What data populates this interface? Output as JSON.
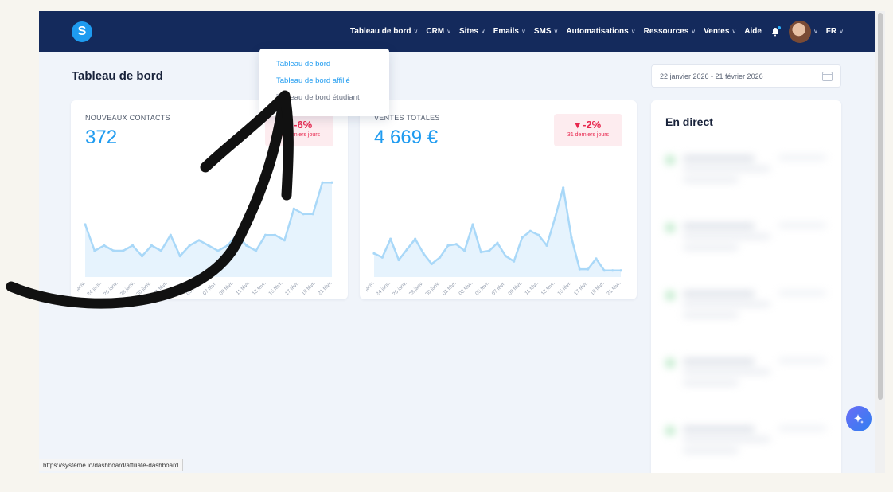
{
  "app": {
    "logo_letter": "S"
  },
  "nav": {
    "items": [
      {
        "label": "Tableau de bord",
        "has_chevron": true
      },
      {
        "label": "CRM",
        "has_chevron": true
      },
      {
        "label": "Sites",
        "has_chevron": true
      },
      {
        "label": "Emails",
        "has_chevron": true
      },
      {
        "label": "SMS",
        "has_chevron": true
      },
      {
        "label": "Automatisations",
        "has_chevron": true
      },
      {
        "label": "Ressources",
        "has_chevron": true
      },
      {
        "label": "Ventes",
        "has_chevron": true
      },
      {
        "label": "Aide",
        "has_chevron": false
      }
    ],
    "language": "FR",
    "icons": {
      "notifications": "bell-icon",
      "avatar": "user-avatar"
    }
  },
  "dropdown": {
    "items": [
      {
        "label": "Tableau de bord"
      },
      {
        "label": "Tableau de bord affilié"
      },
      {
        "label": "Tableau de bord étudiant"
      }
    ]
  },
  "page": {
    "title": "Tableau de bord",
    "date_range": "22 janvier 2026 - 21 février 2026"
  },
  "cards": {
    "contacts": {
      "label": "NOUVEAUX CONTACTS",
      "value": "372",
      "badge_pct": "-6%",
      "badge_sub": "31 derniers jours"
    },
    "sales": {
      "label": "VENTES TOTALES",
      "value": "4 669 €",
      "badge_pct": "-2%",
      "badge_sub": "31 derniers jours"
    },
    "live": {
      "title": "En direct"
    }
  },
  "status_bar": {
    "url": "https://systeme.io/dashboard/affiliate-dashboard"
  },
  "colors": {
    "nav_bg": "#142a5c",
    "accent": "#1e9bf0",
    "negative": "#e8284f",
    "chart_fill": "#e6f3fd"
  },
  "chart_data": [
    {
      "type": "area",
      "categories": [
        "23 janv.",
        "25 janv.",
        "27 janv.",
        "29 janv.",
        "31 janv.",
        "02 févr.",
        "04 févr.",
        "06 févr.",
        "08 févr.",
        "10 févr.",
        "12 févr.",
        "14 févr.",
        "16 févr.",
        "18 févr.",
        "20 févr.",
        "21 févr."
      ],
      "x_tick_labels": [
        "23 janv.",
        "24 janv.",
        "26 janv.",
        "28 janv.",
        "30 janv.",
        "01 févr.",
        "03 févr.",
        "05 févr.",
        "07 févr.",
        "09 févr.",
        "11 févr.",
        "13 févr.",
        "15 févr.",
        "17 févr.",
        "19 févr.",
        "21 févr."
      ],
      "values": [
        10,
        5,
        6,
        5,
        5,
        6,
        4,
        6,
        5,
        8,
        4,
        6,
        7,
        6,
        5,
        6,
        8,
        6,
        5,
        8,
        8,
        7,
        13,
        12,
        12,
        18,
        18
      ],
      "ylim": [
        0,
        20
      ],
      "grid": false
    },
    {
      "type": "area",
      "x_tick_labels": [
        "23 janv.",
        "24 janv.",
        "26 janv.",
        "28 janv.",
        "30 janv.",
        "01 févr.",
        "03 févr.",
        "05 févr.",
        "07 févr.",
        "09 févr.",
        "11 févr.",
        "13 févr.",
        "15 févr.",
        "17 févr.",
        "19 févr.",
        "21 févr."
      ],
      "values": [
        180,
        150,
        290,
        130,
        210,
        290,
        180,
        100,
        150,
        240,
        250,
        200,
        400,
        190,
        200,
        260,
        160,
        120,
        300,
        350,
        320,
        240,
        450,
        680,
        300,
        60,
        60,
        140,
        50,
        50,
        50
      ],
      "ylim": [
        0,
        800
      ],
      "grid": false
    }
  ]
}
